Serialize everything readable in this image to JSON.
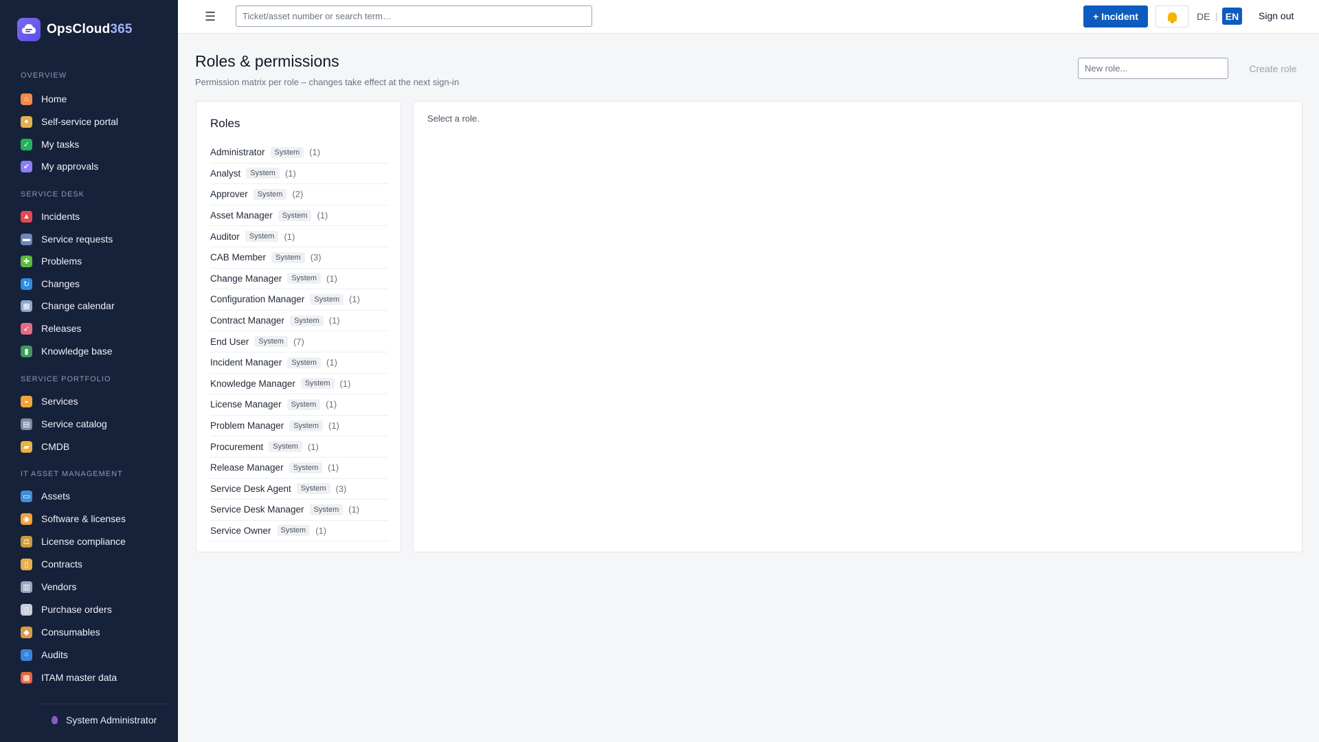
{
  "sidebar": {
    "brand": {
      "name": "OpsCloud",
      "suffix": "365",
      "logo_icon": "cloud-chat-icon"
    },
    "sections": [
      {
        "label": "OVERVIEW",
        "items": [
          {
            "label": "Home",
            "icon": "home-icon",
            "color": "#f28a4b"
          },
          {
            "label": "Self-service portal",
            "icon": "person-icon",
            "color": "#e3b04b"
          },
          {
            "label": "My tasks",
            "icon": "checkbox-icon",
            "color": "#22b35a"
          },
          {
            "label": "My approvals",
            "icon": "checkmark-icon",
            "color": "#8b7cf6"
          }
        ]
      },
      {
        "label": "SERVICE DESK",
        "items": [
          {
            "label": "Incidents",
            "icon": "siren-icon",
            "color": "#e5484d"
          },
          {
            "label": "Service requests",
            "icon": "inbox-icon",
            "color": "#6f86b8"
          },
          {
            "label": "Problems",
            "icon": "puzzle-icon",
            "color": "#5dbb3b"
          },
          {
            "label": "Changes",
            "icon": "cycle-icon",
            "color": "#2a8ee6"
          },
          {
            "label": "Change calendar",
            "icon": "calendar-icon",
            "color": "#8fa6c9"
          },
          {
            "label": "Releases",
            "icon": "rocket-icon",
            "color": "#e56a86"
          },
          {
            "label": "Knowledge base",
            "icon": "books-icon",
            "color": "#3f9a5a"
          }
        ]
      },
      {
        "label": "SERVICE PORTFOLIO",
        "items": [
          {
            "label": "Services",
            "icon": "bell-service-icon",
            "color": "#f0a43b"
          },
          {
            "label": "Service catalog",
            "icon": "catalog-icon",
            "color": "#7d8aa5"
          },
          {
            "label": "CMDB",
            "icon": "folder-icon",
            "color": "#e9b23b"
          }
        ]
      },
      {
        "label": "IT ASSET MANAGEMENT",
        "items": [
          {
            "label": "Assets",
            "icon": "laptop-icon",
            "color": "#3f8fd6"
          },
          {
            "label": "Software & licenses",
            "icon": "disc-icon",
            "color": "#f0a23a"
          },
          {
            "label": "License compliance",
            "icon": "scales-icon",
            "color": "#c89b3c"
          },
          {
            "label": "Contracts",
            "icon": "scroll-icon",
            "color": "#e8b04a"
          },
          {
            "label": "Vendors",
            "icon": "building-icon",
            "color": "#9aa7bd"
          },
          {
            "label": "Purchase orders",
            "icon": "receipt-icon",
            "color": "#c9cfdb"
          },
          {
            "label": "Consumables",
            "icon": "box-icon",
            "color": "#d99a4a"
          },
          {
            "label": "Audits",
            "icon": "magnifier-icon",
            "color": "#3a85d9"
          },
          {
            "label": "ITAM master data",
            "icon": "bricks-icon",
            "color": "#e0683c"
          }
        ]
      }
    ],
    "user": "System Administrator"
  },
  "topbar": {
    "search_placeholder": "Ticket/asset number or search term…",
    "incident_button": "+ Incident",
    "lang_de": "DE",
    "lang_sep": "|",
    "lang_en": "EN",
    "sign_out": "Sign out"
  },
  "page": {
    "title": "Roles & permissions",
    "subtitle": "Permission matrix per role – changes take effect at the next sign-in",
    "new_role_placeholder": "New role...",
    "create_role": "Create role"
  },
  "roles": {
    "heading": "Roles",
    "items": [
      {
        "name": "Administrator",
        "badge": "System",
        "count": "(1)"
      },
      {
        "name": "Analyst",
        "badge": "System",
        "count": "(1)"
      },
      {
        "name": "Approver",
        "badge": "System",
        "count": "(2)"
      },
      {
        "name": "Asset Manager",
        "badge": "System",
        "count": "(1)"
      },
      {
        "name": "Auditor",
        "badge": "System",
        "count": "(1)"
      },
      {
        "name": "CAB Member",
        "badge": "System",
        "count": "(3)"
      },
      {
        "name": "Change Manager",
        "badge": "System",
        "count": "(1)"
      },
      {
        "name": "Configuration Manager",
        "badge": "System",
        "count": "(1)"
      },
      {
        "name": "Contract Manager",
        "badge": "System",
        "count": "(1)"
      },
      {
        "name": "End User",
        "badge": "System",
        "count": "(7)"
      },
      {
        "name": "Incident Manager",
        "badge": "System",
        "count": "(1)"
      },
      {
        "name": "Knowledge Manager",
        "badge": "System",
        "count": "(1)"
      },
      {
        "name": "License Manager",
        "badge": "System",
        "count": "(1)"
      },
      {
        "name": "Problem Manager",
        "badge": "System",
        "count": "(1)"
      },
      {
        "name": "Procurement",
        "badge": "System",
        "count": "(1)"
      },
      {
        "name": "Release Manager",
        "badge": "System",
        "count": "(1)"
      },
      {
        "name": "Service Desk Agent",
        "badge": "System",
        "count": "(3)"
      },
      {
        "name": "Service Desk Manager",
        "badge": "System",
        "count": "(1)"
      },
      {
        "name": "Service Owner",
        "badge": "System",
        "count": "(1)"
      }
    ]
  },
  "detail": {
    "message": "Select a role."
  }
}
